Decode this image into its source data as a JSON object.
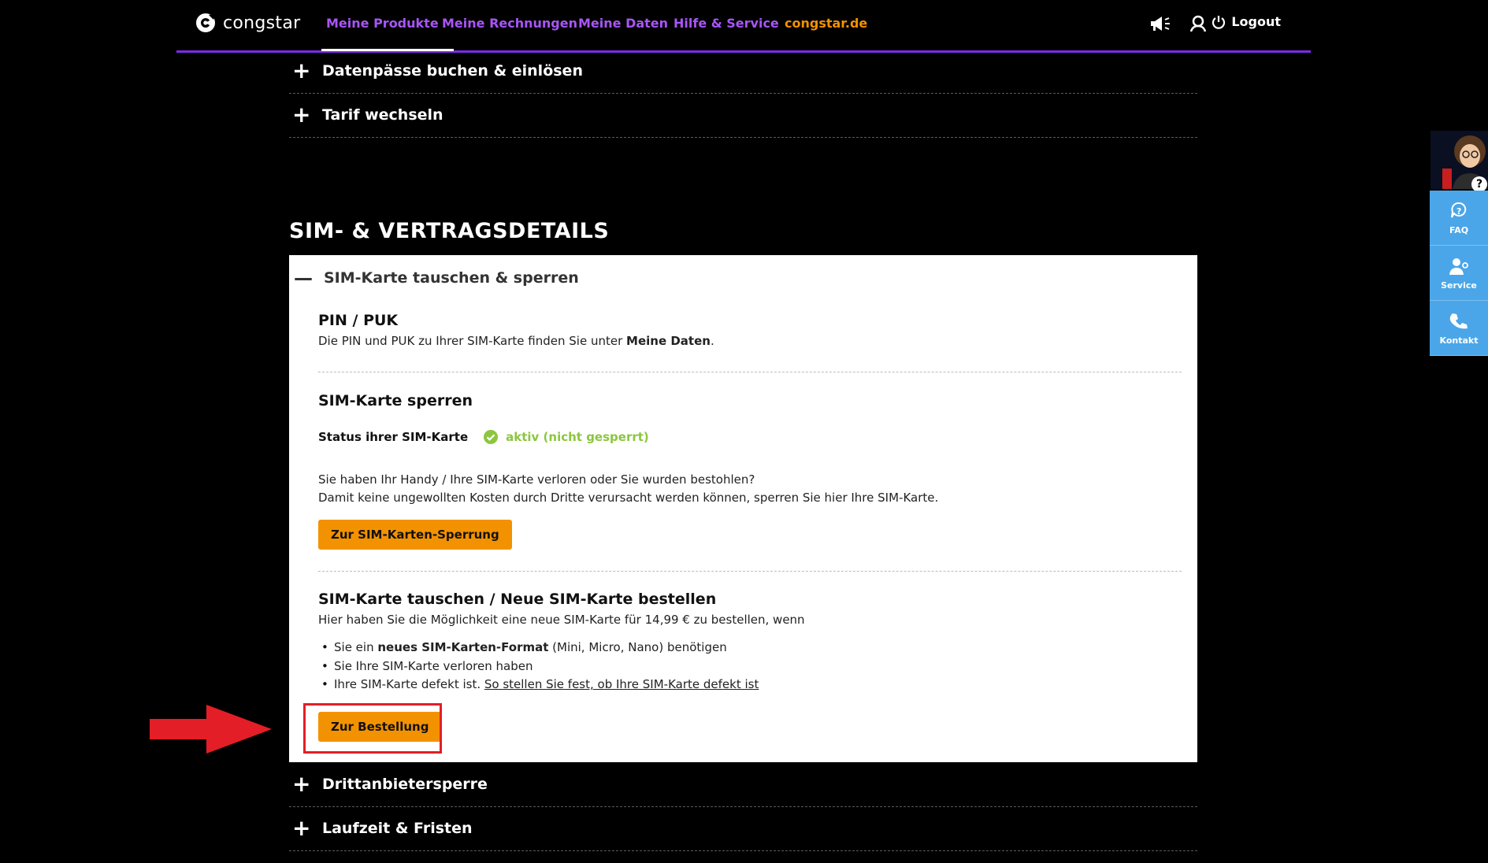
{
  "header": {
    "logo_text": "congstar",
    "nav": [
      {
        "label": "Meine Produkte"
      },
      {
        "label": "Meine Rechnungen"
      },
      {
        "label": "Meine Daten"
      },
      {
        "label": "Hilfe & Service"
      },
      {
        "label": "congstar.de"
      }
    ],
    "logout_label": "Logout",
    "icons": [
      "megaphone-icon",
      "user-icon",
      "power-icon"
    ],
    "colors": {
      "nav": "#a855f7",
      "nav_external": "#f39200",
      "divider": "#7d2ae8"
    }
  },
  "accordions_top": [
    {
      "title": "Datenpässe buchen & einlösen"
    },
    {
      "title": "Tarif wechseln"
    }
  ],
  "section_title": "SIM- & VERTRAGSDETAILS",
  "panel": {
    "title": "SIM-Karte tauschen & sperren",
    "pin": {
      "heading": "PIN / PUK",
      "text": "Die PIN und PUK zu Ihrer SIM-Karte finden Sie unter ",
      "text_bold": "Meine Daten",
      "text_end": "."
    },
    "lock": {
      "heading": "SIM-Karte sperren",
      "status_label": "Status ihrer SIM-Karte",
      "status_value": "aktiv (nicht gesperrt)",
      "line1": "Sie haben Ihr Handy / Ihre SIM-Karte verloren oder Sie wurden bestohlen?",
      "line2": "Damit keine ungewollten Kosten durch Dritte verursacht werden können, sperren Sie hier Ihre SIM-Karte.",
      "button": "Zur SIM-Karten-Sperrung"
    },
    "swap": {
      "heading": "SIM-Karte tauschen / Neue SIM-Karte bestellen",
      "intro": "Hier haben Sie die Möglichkeit eine neue SIM-Karte für 14,99 € zu bestellen, wenn",
      "bullet1_pre": "Sie ein ",
      "bullet1_bold": "neues SIM-Karten-Format",
      "bullet1_post": " (Mini, Micro, Nano) benötigen",
      "bullet2": "Sie Ihre SIM-Karte verloren haben",
      "bullet3": "Ihre SIM-Karte defekt ist. ",
      "bullet3_link": "So stellen Sie fest, ob Ihre SIM-Karte defekt ist",
      "button": "Zur Bestellung"
    },
    "colors": {
      "button": "#f39200",
      "status_ok": "#8cc63f"
    }
  },
  "accordions_bottom": [
    {
      "title": "Drittanbietersperre"
    },
    {
      "title": "Laufzeit & Fristen"
    }
  ],
  "side_widget": {
    "help_badge": "?",
    "buttons": [
      {
        "label": "FAQ",
        "icon": "faq-icon"
      },
      {
        "label": "Service",
        "icon": "service-icon"
      },
      {
        "label": "Kontakt",
        "icon": "contact-icon"
      }
    ],
    "color": "#4aa6e8"
  },
  "annotation": {
    "highlight_color": "#e41e26"
  }
}
